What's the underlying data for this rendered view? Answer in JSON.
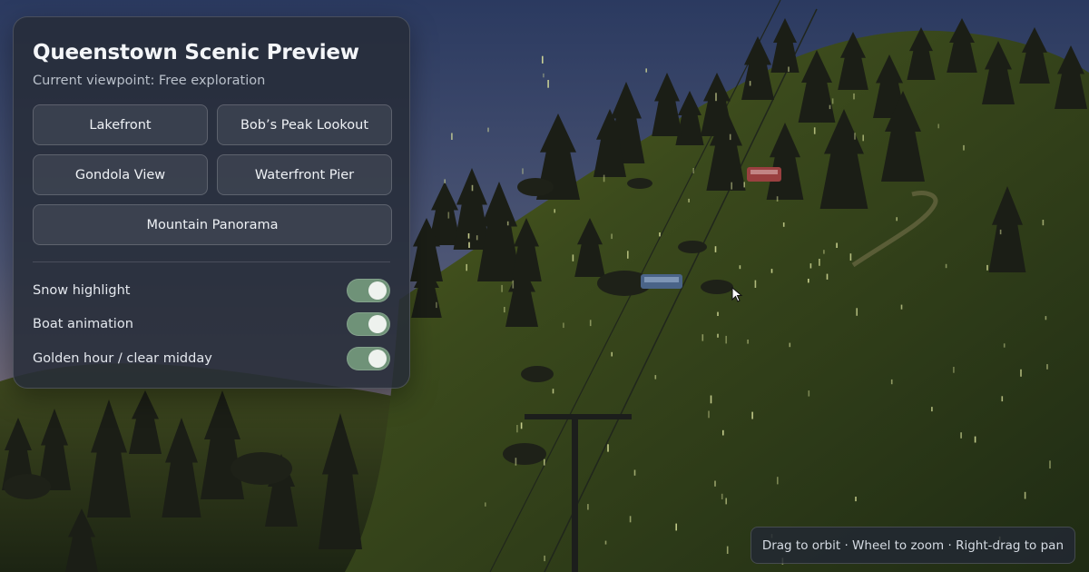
{
  "panel": {
    "title": "Queenstown Scenic Preview",
    "subtitle": "Current viewpoint: Free exploration",
    "viewpoints": [
      "Lakefront",
      "Bob’s Peak Lookout",
      "Gondola View",
      "Waterfront Pier",
      "Mountain Panorama"
    ],
    "toggles": [
      {
        "label": "Snow highlight",
        "on": true
      },
      {
        "label": "Boat animation",
        "on": true
      },
      {
        "label": "Golden hour / clear midday",
        "on": true
      }
    ]
  },
  "hint": "Drag to orbit · Wheel to zoom · Right-drag to pan",
  "colors": {
    "toggle_on": "#6f9278",
    "panel_bg": "#262c38",
    "hill_grass": "#3b4a1c",
    "sky_top": "#2b3a60",
    "sky_horizon": "#7a6e78",
    "gondola_blue": "#4a6488",
    "gondola_red": "#9a4040"
  }
}
